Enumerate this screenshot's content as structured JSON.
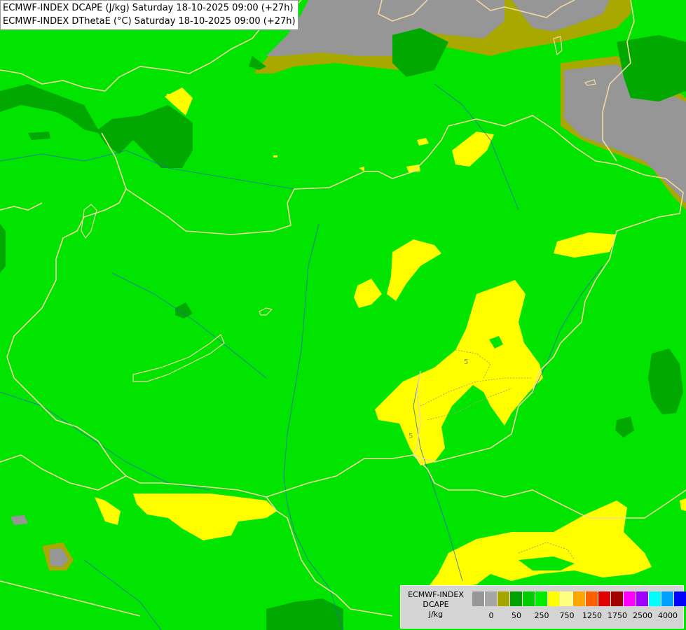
{
  "title": {
    "line1": "ECMWF-INDEX DCAPE (J/kg) Saturday 18-10-2025 09:00 (+27h)",
    "line2": "ECMWF-INDEX DThetaE (°C) Saturday 18-10-2025 09:00 (+27h)"
  },
  "contour_labels": [
    "5",
    "5"
  ],
  "legend": {
    "line1": "ECMWF-INDEX",
    "line2": "DCAPE",
    "line3": "J/kg",
    "colors": [
      "#969696",
      "#a6a6a6",
      "#a5a500",
      "#00a000",
      "#00cc00",
      "#00ee00",
      "#ffff00",
      "#ffff80",
      "#ffa500",
      "#ff6000",
      "#e00000",
      "#a00000",
      "#ff00ff",
      "#a000ff",
      "#00ffff",
      "#00a0ff",
      "#0000ff",
      "#00008b"
    ],
    "ticks": [
      "0",
      "50",
      "250",
      "750",
      "1250",
      "1750",
      "2500",
      "4000"
    ]
  },
  "colors": {
    "background_green": "#00e400",
    "dark_green": "#00a800",
    "yellow": "#ffff00",
    "olive": "#a8a800",
    "gray_terrain": "#969696",
    "border": "#f2d8a0",
    "river": "#2a60c8"
  }
}
